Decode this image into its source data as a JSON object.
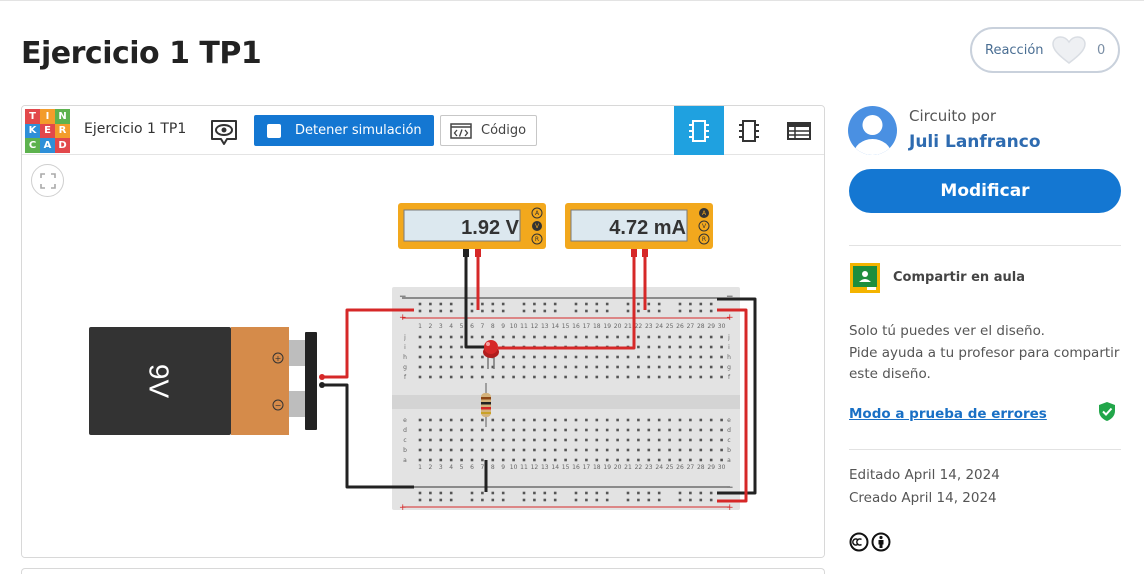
{
  "page": {
    "title": "Ejercicio 1 TP1",
    "reaction": {
      "label": "Reacción",
      "count": "0"
    }
  },
  "editor": {
    "logo_letters": [
      "T",
      "I",
      "N",
      "K",
      "E",
      "R",
      "C",
      "A",
      "D"
    ],
    "project_name": "Ejercicio 1 TP1",
    "stop_sim_label": "Detener simulación",
    "code_label": "Código",
    "views": [
      "circuit-view-icon",
      "component-view-icon",
      "parts-list-icon"
    ],
    "active_view": "circuit-view-icon"
  },
  "circuit": {
    "voltmeter_reading": "1.92 V",
    "ammeter_reading": "4.72 mA",
    "meter_mode_letters": [
      "A",
      "V",
      "R"
    ],
    "battery_label": "9V",
    "battery_terminal_pos": "+",
    "battery_terminal_neg": "−",
    "breadboard_row_labels_top": [
      "j",
      "i",
      "h",
      "g",
      "f"
    ],
    "breadboard_row_labels_bottom": [
      "e",
      "d",
      "c",
      "b",
      "a"
    ],
    "breadboard_columns": 30,
    "colors": {
      "meter_body": "#f2a81d",
      "meter_screen": "#dce8ef",
      "battery_body": "#333333",
      "battery_cap": "#d58b4a",
      "wire_red": "#d62828",
      "wire_black": "#222222",
      "led_red": "#d62828"
    }
  },
  "sidebar": {
    "by_label": "Circuito por",
    "author": "Juli Lanfranco",
    "modify_label": "Modificar",
    "share_label": "Compartir en aula",
    "info_lines": [
      "Solo tú puedes ver el diseño.",
      "Pide ayuda a tu profesor para compartir",
      "este diseño."
    ],
    "error_mode_label": "Modo a prueba de errores",
    "edited": "Editado April 14, 2024",
    "created": "Creado April 14, 2024",
    "accent": "#1477d2"
  }
}
